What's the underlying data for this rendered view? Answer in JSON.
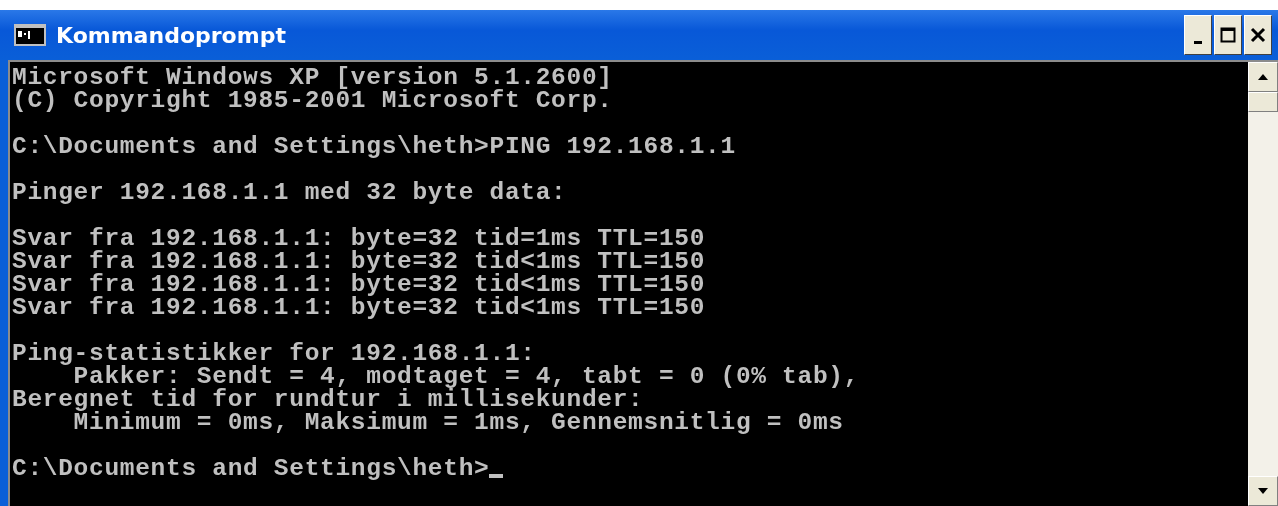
{
  "window": {
    "title": "Kommandoprompt"
  },
  "console": {
    "blocks": [
      [
        "Microsoft Windows XP [version 5.1.2600]",
        "(C) Copyright 1985-2001 Microsoft Corp."
      ],
      [
        "C:\\Documents and Settings\\heth>PING 192.168.1.1"
      ],
      [
        "Pinger 192.168.1.1 med 32 byte data:"
      ],
      [
        "Svar fra 192.168.1.1: byte=32 tid=1ms TTL=150",
        "Svar fra 192.168.1.1: byte=32 tid<1ms TTL=150",
        "Svar fra 192.168.1.1: byte=32 tid<1ms TTL=150",
        "Svar fra 192.168.1.1: byte=32 tid<1ms TTL=150"
      ],
      [
        "Ping-statistikker for 192.168.1.1:",
        "    Pakker: Sendt = 4, modtaget = 4, tabt = 0 (0% tab),",
        "Beregnet tid for rundtur i millisekunder:",
        "    Minimum = 0ms, Maksimum = 1ms, Gennemsnitlig = 0ms"
      ],
      [
        "C:\\Documents and Settings\\heth>"
      ]
    ],
    "cursor": true
  }
}
